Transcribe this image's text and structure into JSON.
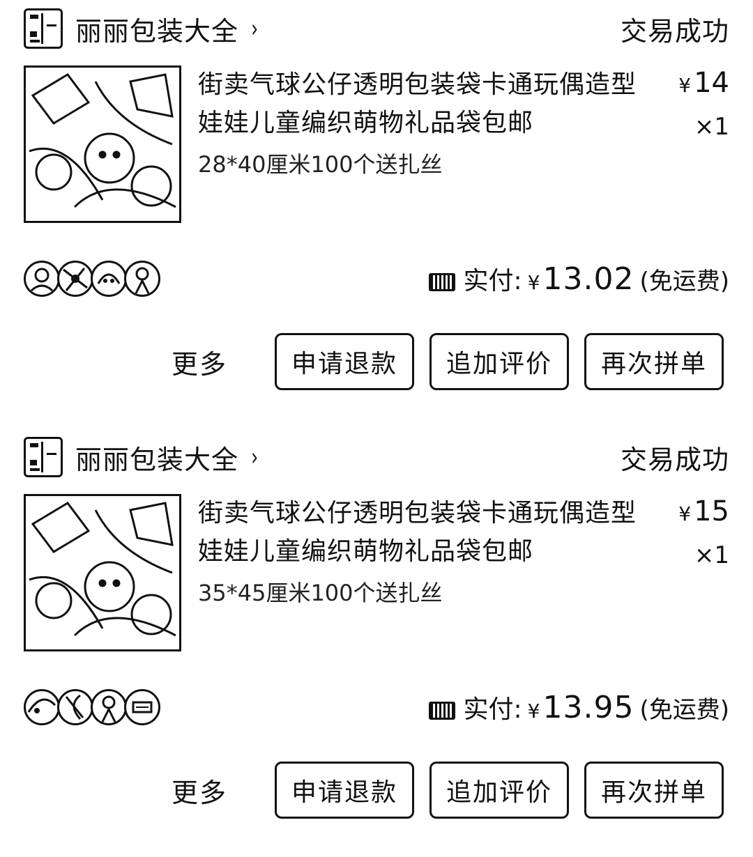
{
  "orders": [
    {
      "shop_name": "丽丽包装大全",
      "chevron": "›",
      "status": "交易成功",
      "product": {
        "title": "街卖气球公仔透明包装袋卡通玩偶造型娃娃儿童编织萌物礼品袋包邮",
        "spec": "28*40厘米100个送扎丝",
        "price_symbol": "¥",
        "price": "14",
        "qty": "×1"
      },
      "payment": {
        "label": "实付:",
        "symbol": "¥",
        "amount": "13.02",
        "note": "(免运费)"
      },
      "actions": {
        "more": "更多",
        "refund": "申请退款",
        "review": "追加评价",
        "reorder": "再次拼单"
      }
    },
    {
      "shop_name": "丽丽包装大全",
      "chevron": "›",
      "status": "交易成功",
      "product": {
        "title": "街卖气球公仔透明包装袋卡通玩偶造型娃娃儿童编织萌物礼品袋包邮",
        "spec": "35*45厘米100个送扎丝",
        "price_symbol": "¥",
        "price": "15",
        "qty": "×1"
      },
      "payment": {
        "label": "实付:",
        "symbol": "¥",
        "amount": "13.95",
        "note": "(免运费)"
      },
      "actions": {
        "more": "更多",
        "refund": "申请退款",
        "review": "追加评价",
        "reorder": "再次拼单"
      }
    }
  ],
  "icons": {
    "shop_logo": "shop-logo-icon",
    "coupon": "coupon-icon",
    "avatar": "avatar-icon"
  }
}
